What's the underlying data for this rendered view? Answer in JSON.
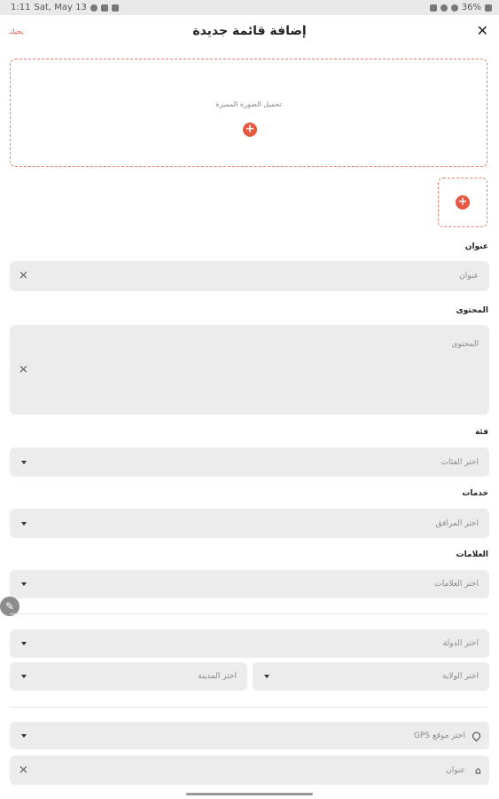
{
  "status_bar": {
    "time": "1:11",
    "date": "Sat, May 13",
    "battery": "36%"
  },
  "header": {
    "title": "إضافة قائمة جديدة",
    "publish_label": "يحيك",
    "close_glyph": "✕"
  },
  "featured_image": {
    "hint": "تحميل الصورة المميزة"
  },
  "form": {
    "title_label": "عنوان",
    "title_placeholder": "عنوان",
    "content_label": "المحتوى",
    "content_placeholder": "المحتوى",
    "category_label": "فئة",
    "category_placeholder": "اختر الفئات",
    "services_label": "خدمات",
    "services_placeholder": "اختر المرافق",
    "tags_label": "العلامات",
    "tags_placeholder": "اختر العلامات",
    "country_placeholder": "اختر الدولة",
    "state_placeholder": "اختر الولاية",
    "city_placeholder": "اختر المدينة",
    "gps_placeholder": "اختر موقع GPS",
    "address_placeholder": "عنوان"
  },
  "colors": {
    "accent": "#e8573f",
    "field_bg": "#ececec"
  }
}
